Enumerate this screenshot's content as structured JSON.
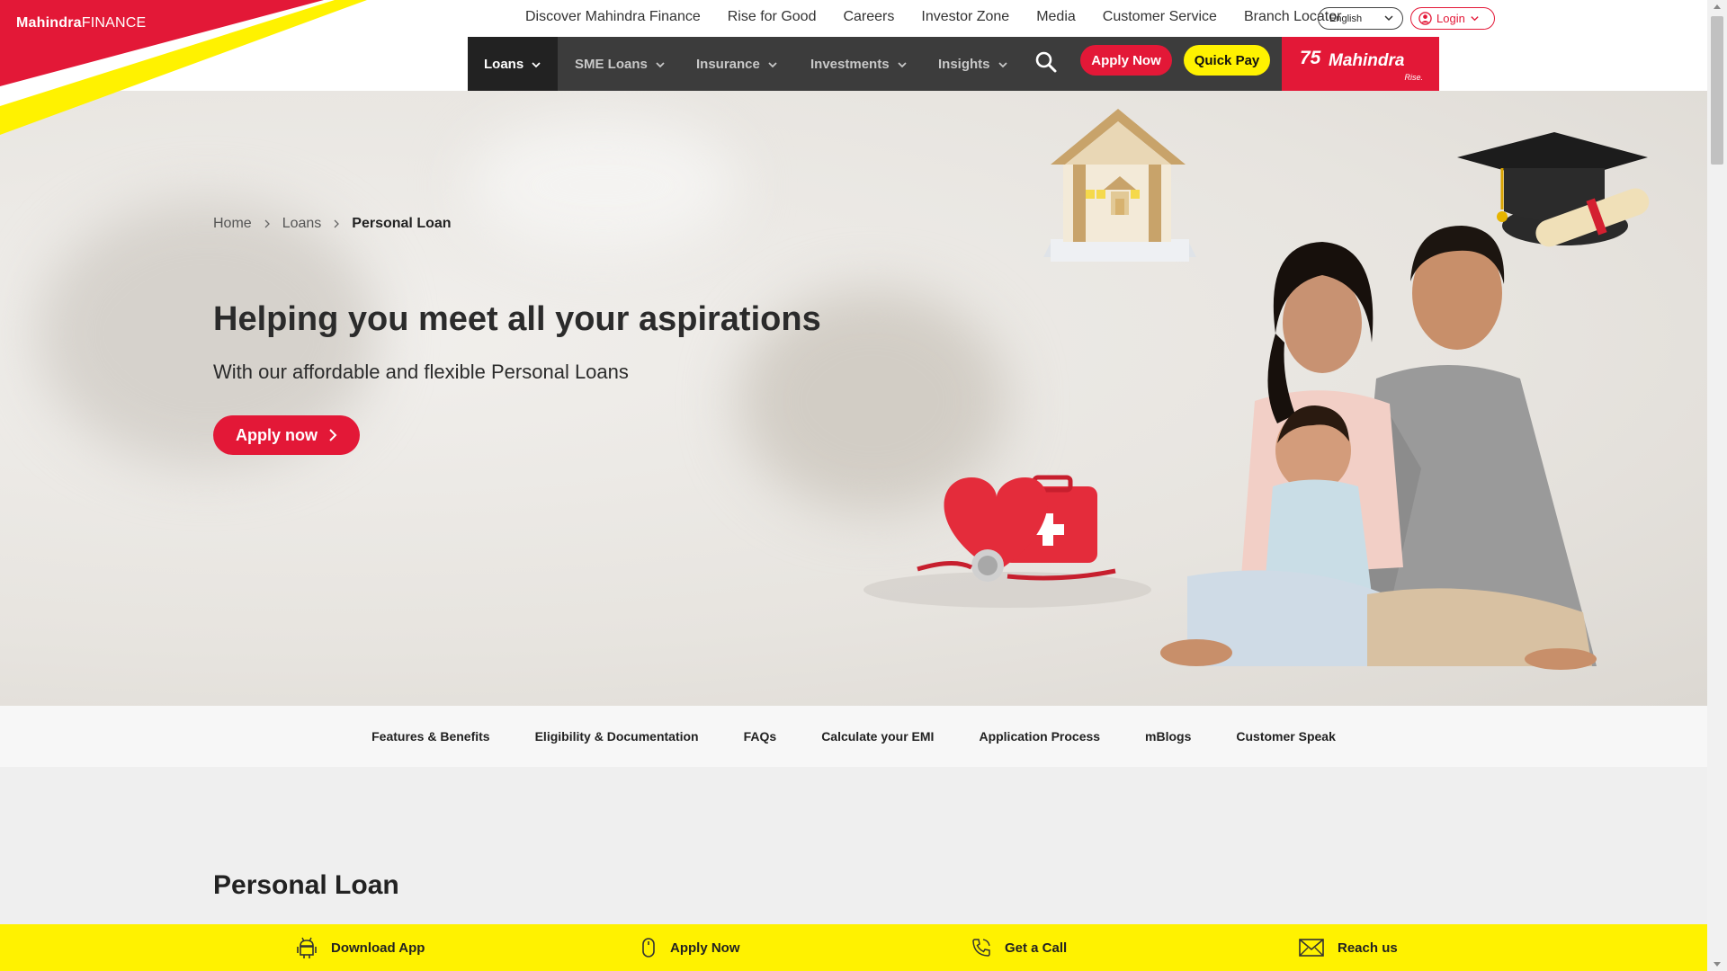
{
  "brand": {
    "logo_bold": "Mahindra",
    "logo_thin": "FINANCE",
    "badge_number": "75",
    "badge_name": "Mahindra",
    "badge_tagline": "Rise."
  },
  "topnav": {
    "links": [
      "Discover Mahindra Finance",
      "Rise for Good",
      "Careers",
      "Investor Zone",
      "Media",
      "Customer Service",
      "Branch Locator"
    ],
    "language": "English",
    "login": "Login"
  },
  "mainnav": {
    "items": [
      "Loans",
      "SME Loans",
      "Insurance",
      "Investments",
      "Insights"
    ],
    "apply_now": "Apply Now",
    "quick_pay": "Quick Pay"
  },
  "breadcrumb": {
    "home": "Home",
    "loans": "Loans",
    "current": "Personal Loan"
  },
  "hero": {
    "title": "Helping you meet all your aspirations",
    "subtitle": "With our affordable and flexible Personal Loans",
    "cta": "Apply now"
  },
  "section_tabs": [
    "Features & Benefits",
    "Eligibility & Documentation",
    "FAQs",
    "Calculate your EMI",
    "Application Process",
    "mBlogs",
    "Customer Speak"
  ],
  "content": {
    "title": "Personal Loan"
  },
  "bottom_bar": {
    "download": "Download App",
    "apply": "Apply Now",
    "call": "Get a Call",
    "reach": "Reach us"
  },
  "colors": {
    "brand_red": "#e31837",
    "brand_yellow": "#fff200",
    "nav_dark": "#3c3c3c"
  }
}
